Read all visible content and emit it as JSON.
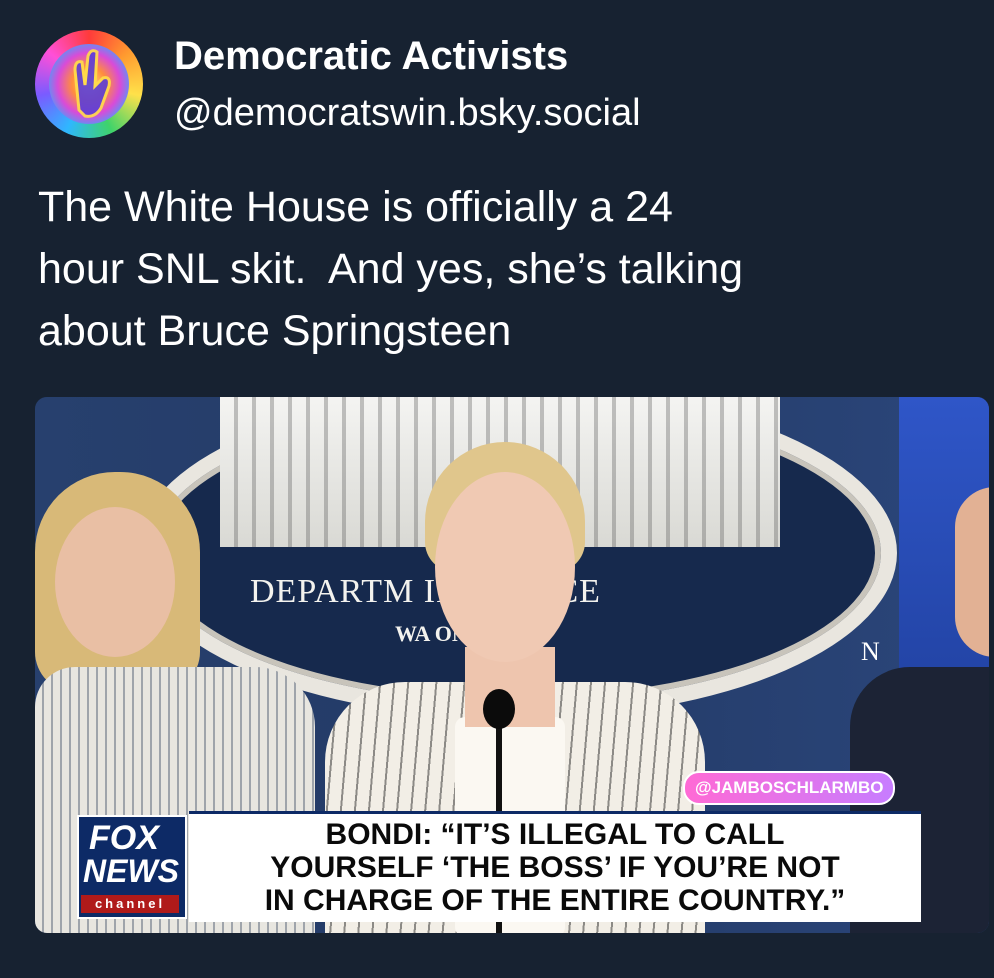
{
  "post": {
    "author_name": "Democratic Activists",
    "author_handle": "@democratswin.bsky.social",
    "text": "The White House is officially a 24\nhour SNL skit.  And yes, she’s talking\nabout Bruce Springsteen"
  },
  "media": {
    "seal_text": "DEPARTM        INJUSTICE",
    "seal_subtext": "WA        ON",
    "side_letter": "N",
    "watermark": "@JAMBOSCHLARMBO",
    "network_logo": {
      "line1": "FOX",
      "line2": "NEWS",
      "line3": "channel"
    },
    "chyron": "BONDI: “IT’S ILLEGAL TO CALL\nYOURSELF ‘THE BOSS’ IF YOU’RE NOT\nIN CHARGE OF THE ENTIRE COUNTRY.”"
  },
  "colors": {
    "background": "#172231",
    "text": "#ffffff",
    "chyron_bg": "#ffffff",
    "fox_blue": "#0d2a66"
  }
}
